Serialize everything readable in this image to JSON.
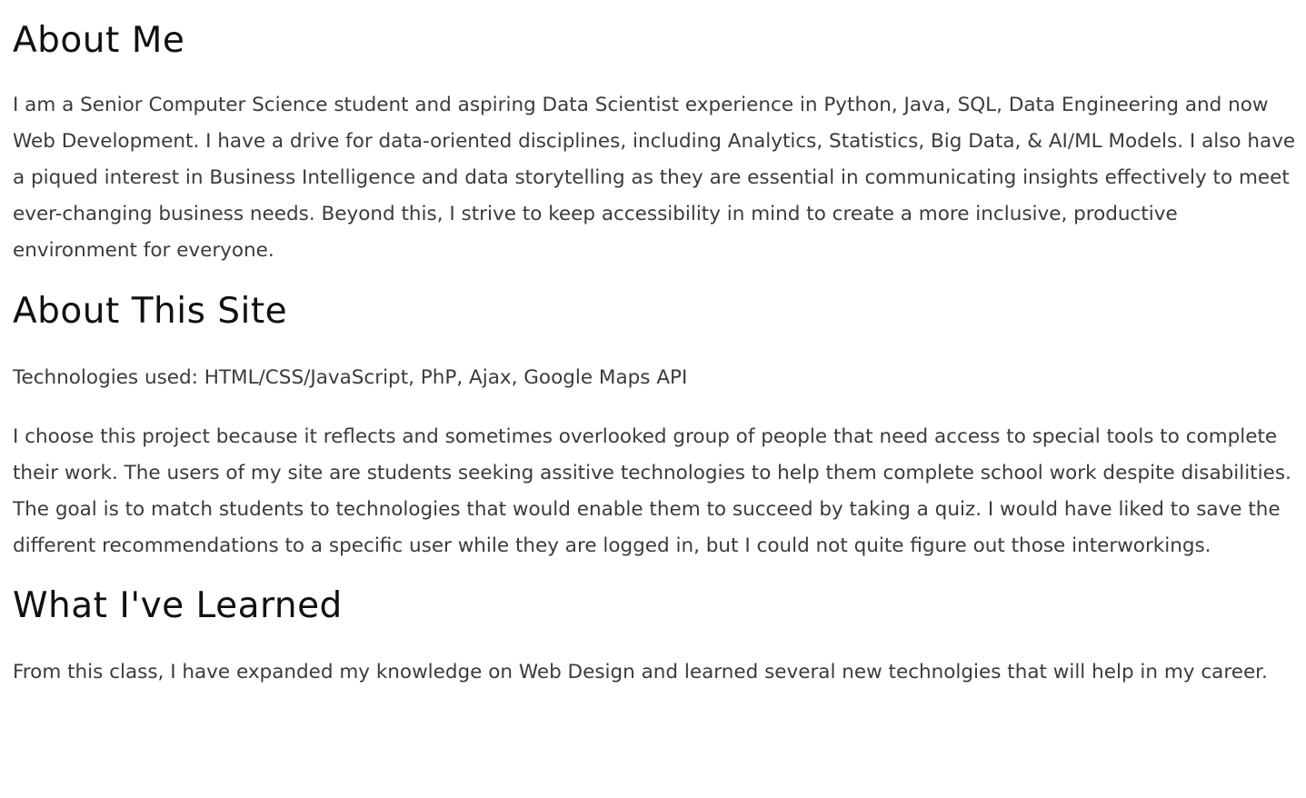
{
  "about_me": {
    "heading": "About Me",
    "text": "I am a Senior Computer Science student and aspiring Data Scientist experience in Python, Java, SQL, Data Engineering and now Web Development. I have a drive for data-oriented disciplines, including Analytics, Statistics, Big Data, & AI/ML Models. I also have a piqued interest in Business Intelligence and data storytelling as they are essential in communicating insights effectively to meet ever-changing business needs. Beyond this, I strive to keep accessibility in mind to create a more inclusive, productive environment for everyone."
  },
  "about_site": {
    "heading": "About This Site",
    "technologies": "Technologies used: HTML/CSS/JavaScript, PhP, Ajax, Google Maps API",
    "description": "I choose this project because it reflects and sometimes overlooked group of people that need access to special tools to complete their work. The users of my site are students seeking assitive technologies to help them complete school work despite disabilities. The goal is to match students to technologies that would enable them to succeed by taking a quiz. I would have liked to save the different recommendations to a specific user while they are logged in, but I could not quite figure out those interworkings."
  },
  "learned": {
    "heading": "What I've Learned",
    "text": "From this class, I have expanded my knowledge on Web Design and learned several new technolgies that will help in my career."
  }
}
